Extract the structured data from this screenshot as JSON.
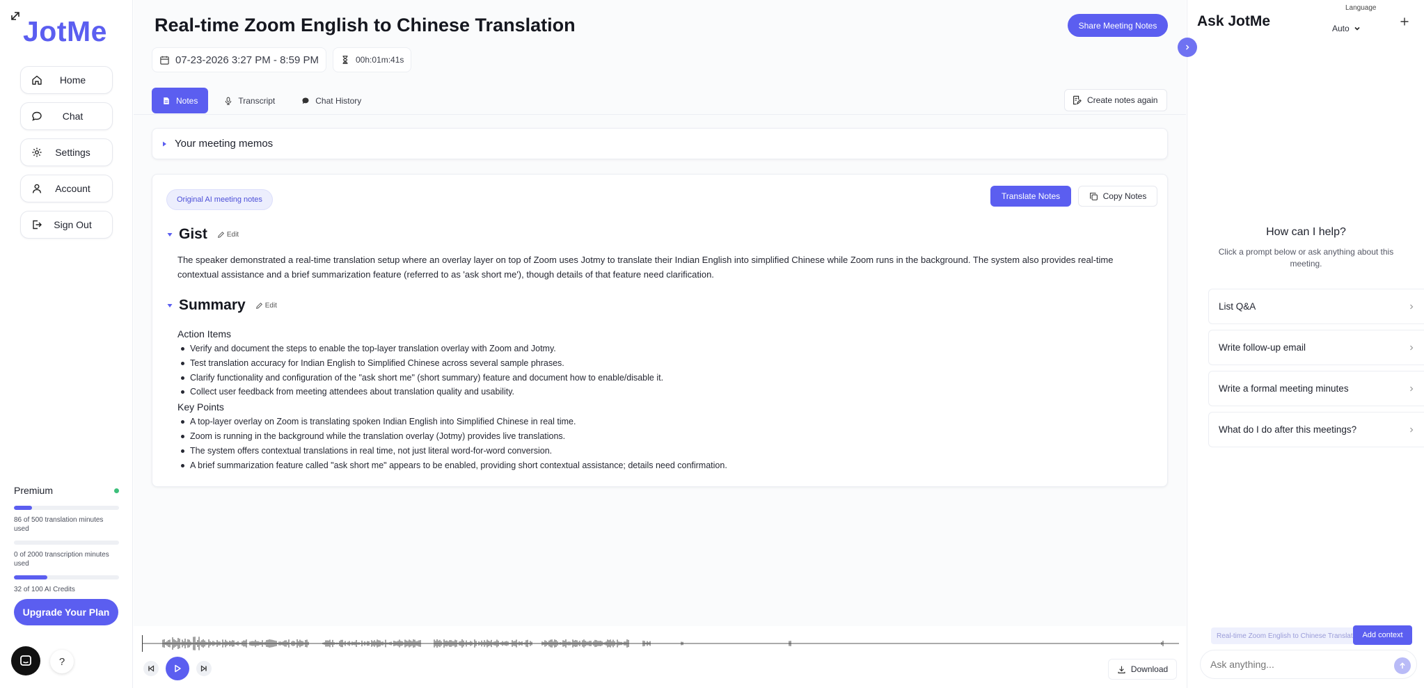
{
  "sidebar": {
    "logo": "JotMe",
    "nav": [
      {
        "label": "Home",
        "icon": "home-icon"
      },
      {
        "label": "Chat",
        "icon": "chat-icon"
      },
      {
        "label": "Settings",
        "icon": "gear-icon"
      },
      {
        "label": "Account",
        "icon": "user-icon"
      },
      {
        "label": "Sign Out",
        "icon": "sign-out-icon"
      }
    ],
    "plan": {
      "name": "Premium",
      "status_color": "#3dbf7b",
      "meters": [
        {
          "text": "86 of 500 translation minutes used",
          "fraction": 0.172
        },
        {
          "text": "0 of 2000 transcription minutes used",
          "fraction": 0.0
        },
        {
          "text": "32 of 100 AI Credits",
          "fraction": 0.32
        }
      ]
    },
    "upgrade_label": "Upgrade Your Plan",
    "help_label": "?"
  },
  "main": {
    "title": "Real-time Zoom English to Chinese Translation",
    "share_label": "Share Meeting Notes",
    "datetime": "07-23-2026 3:27 PM - 8:59 PM",
    "duration": "00h:01m:41s",
    "tabs": [
      {
        "label": "Notes",
        "active": true
      },
      {
        "label": "Transcript",
        "active": false
      },
      {
        "label": "Chat History",
        "active": false
      }
    ],
    "create_again_label": "Create notes again",
    "memos_label": "Your meeting memos",
    "notes": {
      "badge": "Original AI meeting notes",
      "translate_label": "Translate Notes",
      "copy_label": "Copy Notes",
      "edit_label": "Edit",
      "gist_title": "Gist",
      "gist_text": "The speaker demonstrated a real-time translation setup where an overlay layer on top of Zoom uses Jotmy to translate their Indian English into simplified Chinese while Zoom runs in the background. The system also provides real-time contextual assistance and a brief summarization feature (referred to as 'ask short me'), though details of that feature need clarification.",
      "summary_title": "Summary",
      "action_items_heading": "Action Items",
      "action_items": [
        "Verify and document the steps to enable the top-layer translation overlay with Zoom and Jotmy.",
        "Test translation accuracy for Indian English to Simplified Chinese across several sample phrases.",
        "Clarify functionality and configuration of the \"ask short me\" (short summary) feature and document how to enable/disable it.",
        "Collect user feedback from meeting attendees about translation quality and usability."
      ],
      "key_points_heading": "Key Points",
      "key_points": [
        "A top-layer overlay on Zoom is translating spoken Indian English into Simplified Chinese in real time.",
        "Zoom is running in the background while the translation overlay (Jotmy) provides live translations.",
        "The system offers contextual translations in real time, not just literal word-for-word conversion.",
        "A brief summarization feature called \"ask short me\" appears to be enabled, providing short contextual assistance; details need confirmation."
      ]
    },
    "player": {
      "download_label": "Download"
    }
  },
  "assistant": {
    "title": "Ask JotMe",
    "language_label": "Language",
    "language_value": "Auto",
    "help_title": "How can I help?",
    "help_sub": "Click a prompt below or ask anything about this meeting.",
    "prompts": [
      "List Q&A",
      "Write follow-up email",
      "Write a formal meeting minutes",
      "What do I do after this meetings?"
    ],
    "context_chip": "Real-time Zoom English to Chinese Translation",
    "add_context_label": "Add context",
    "input_placeholder": "Ask anything..."
  },
  "colors": {
    "accent": "#5b5ef0",
    "accent_soft": "#eceefd"
  }
}
